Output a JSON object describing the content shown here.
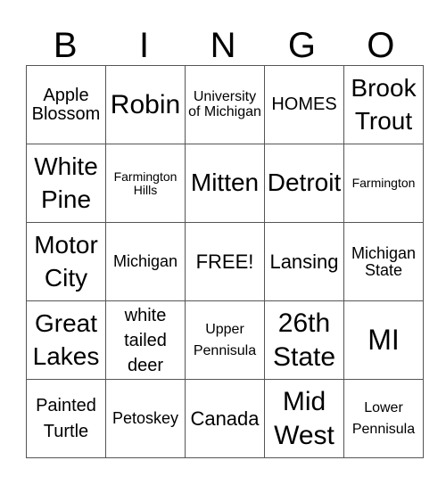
{
  "header": [
    "B",
    "I",
    "N",
    "G",
    "O"
  ],
  "rows": [
    [
      "Apple Blossom",
      "Robin",
      "University of Michigan",
      "HOMES",
      "Brook Trout"
    ],
    [
      "White Pine",
      "Farmington Hills",
      "Mitten",
      "Detroit",
      "Farmington"
    ],
    [
      "Motor City",
      "Michigan",
      "FREE!",
      "Lansing",
      "Michigan State"
    ],
    [
      "Great Lakes",
      "white tailed deer",
      "Upper Pennisula",
      "26th State",
      "MI"
    ],
    [
      "Painted Turtle",
      "Petoskey",
      "Canada",
      "Mid West",
      "Lower Pennisula"
    ]
  ]
}
